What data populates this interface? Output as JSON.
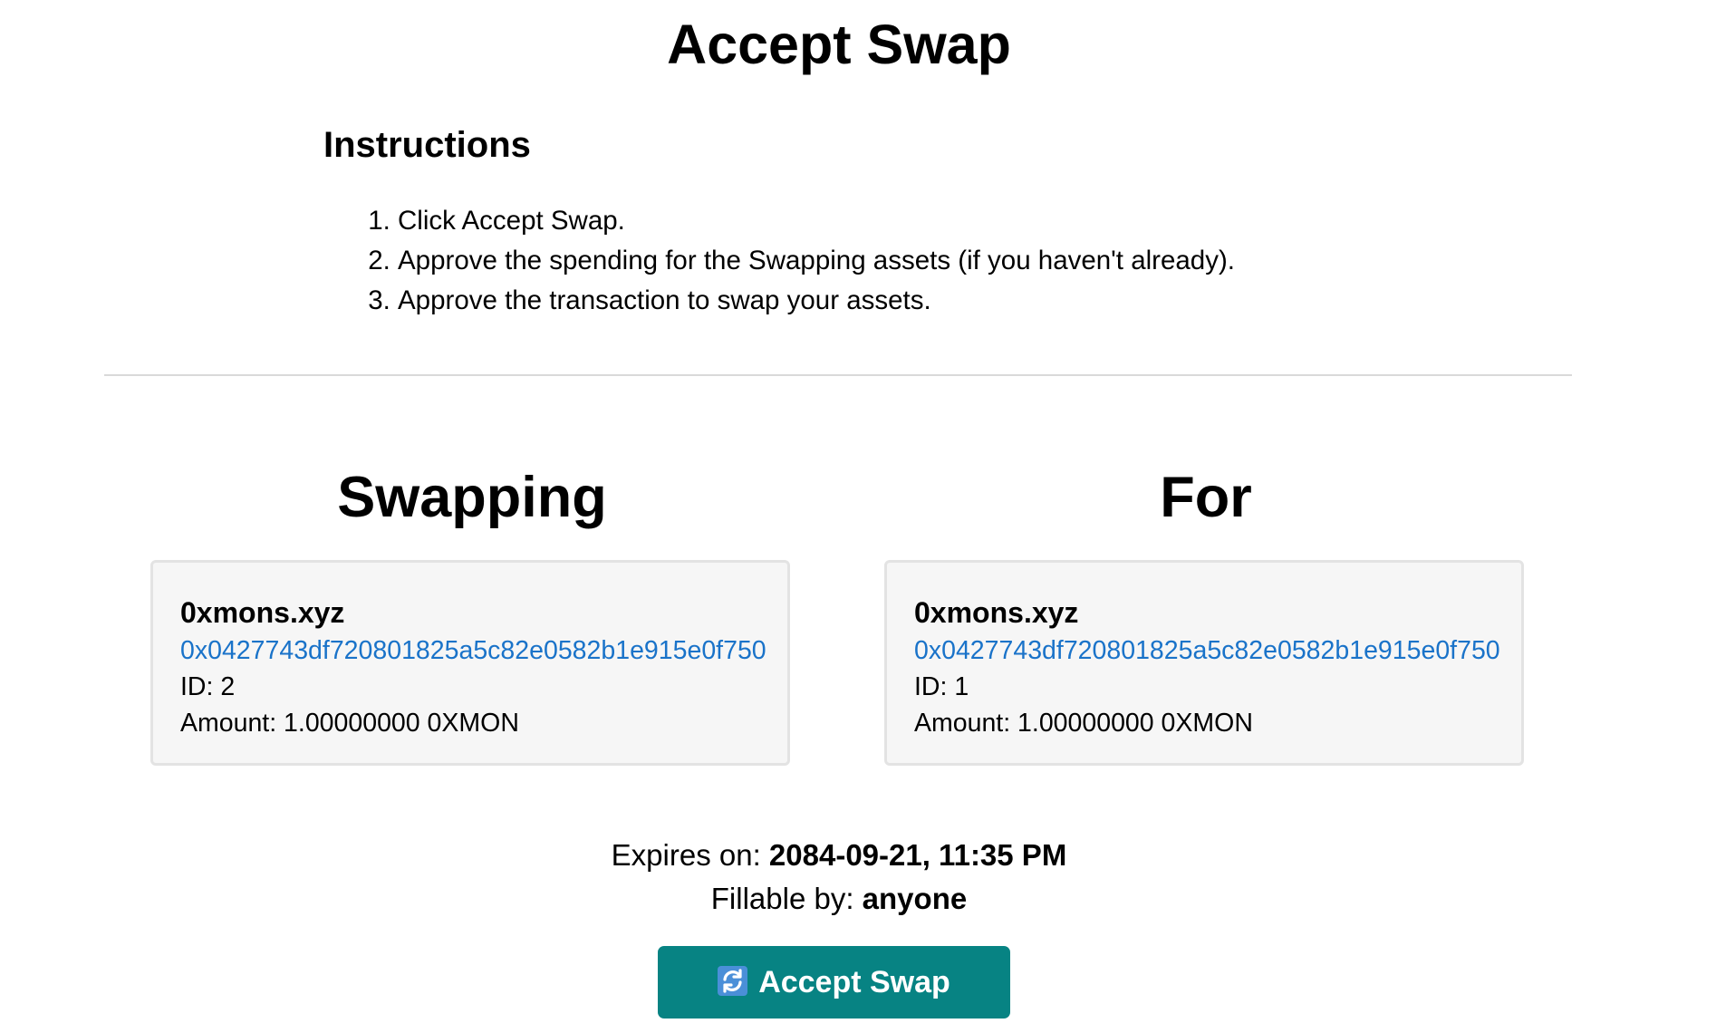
{
  "page": {
    "title": "Accept Swap"
  },
  "instructions": {
    "heading": "Instructions",
    "steps": [
      "Click Accept Swap.",
      "Approve the spending for the Swapping assets (if you haven't already).",
      "Approve the transaction to swap your assets."
    ]
  },
  "swapping": {
    "heading": "Swapping",
    "asset": {
      "name": "0xmons.xyz",
      "address": "0x0427743df720801825a5c82e0582b1e915e0f750",
      "id_label": "ID: 2",
      "amount_label": "Amount: 1.00000000 0XMON"
    }
  },
  "for": {
    "heading": "For",
    "asset": {
      "name": "0xmons.xyz",
      "address": "0x0427743df720801825a5c82e0582b1e915e0f750",
      "id_label": "ID: 1",
      "amount_label": "Amount: 1.00000000 0XMON"
    }
  },
  "meta": {
    "expires_label": "Expires on: ",
    "expires_value": "2084-09-21, 11:35 PM",
    "fillable_label": "Fillable by: ",
    "fillable_value": "anyone"
  },
  "action": {
    "icon": "swap-arrows-icon",
    "label": "Accept Swap"
  },
  "colors": {
    "button_bg": "#078383",
    "link": "#1a73c9",
    "card_bg": "#f6f6f6",
    "icon_bg": "#4a8fd8"
  }
}
